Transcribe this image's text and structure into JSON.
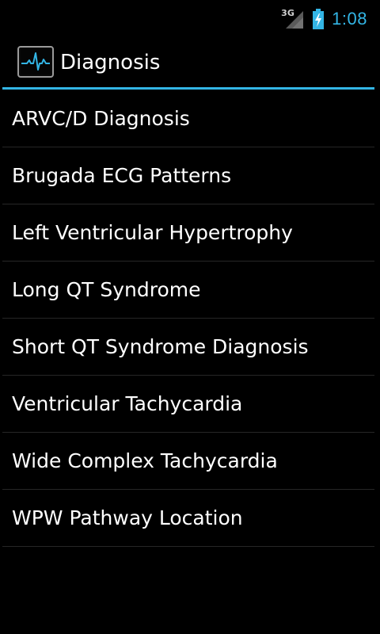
{
  "status_bar": {
    "network_type": "3G",
    "time": "1:08",
    "signal_icon": "cell-signal-icon",
    "battery_icon": "battery-charging-icon"
  },
  "action_bar": {
    "icon": "ecg-heartbeat-icon",
    "title": "Diagnosis"
  },
  "colors": {
    "accent": "#33b5e5",
    "background": "#000000",
    "divider": "#262626",
    "text": "#ffffff"
  },
  "list": {
    "items": [
      {
        "label": "ARVC/D Diagnosis"
      },
      {
        "label": "Brugada ECG Patterns"
      },
      {
        "label": "Left Ventricular Hypertrophy"
      },
      {
        "label": "Long QT Syndrome"
      },
      {
        "label": "Short QT Syndrome Diagnosis"
      },
      {
        "label": "Ventricular Tachycardia"
      },
      {
        "label": "Wide Complex Tachycardia"
      },
      {
        "label": "WPW Pathway Location"
      }
    ]
  }
}
